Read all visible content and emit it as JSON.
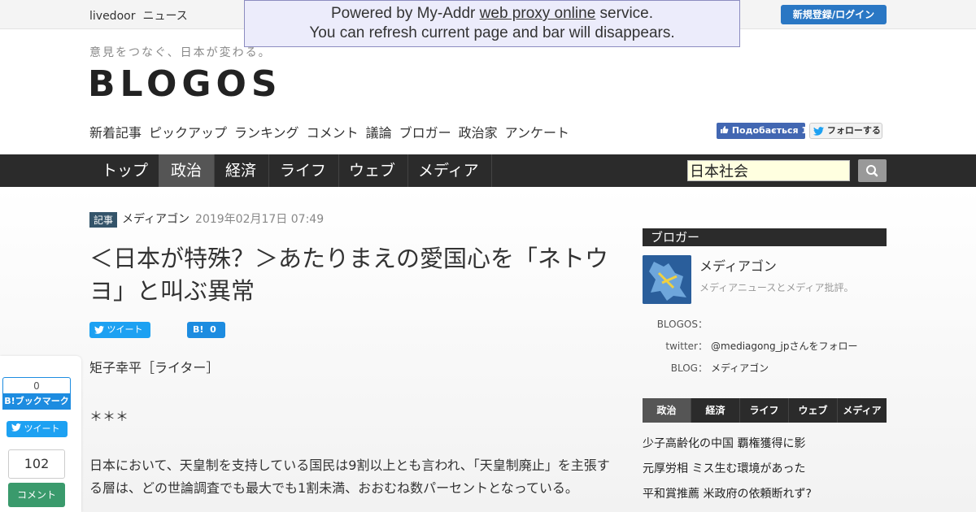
{
  "topbar": {
    "site_name": "livedoor",
    "site_section": "ニュース",
    "login_label": "新規登録/ログイン"
  },
  "proxy_banner": {
    "line1_prefix": "Powered by My-Addr ",
    "line1_link": "web proxy online",
    "line1_suffix": " service.",
    "line2": "You can refresh current page and bar will disappears."
  },
  "header": {
    "tagline": "意見をつなぐ、日本が変わる。",
    "logo": "BLOGOS",
    "subnav": [
      "新着記事",
      "ピックアップ",
      "ランキング",
      "コメント",
      "議論",
      "ブロガー",
      "政治家",
      "アンケート"
    ],
    "fb_label": "Подобається 13",
    "follow_label": "フォローする"
  },
  "mainnav": {
    "tabs": [
      "トップ",
      "政治",
      "経済",
      "ライフ",
      "ウェブ",
      "メディア"
    ],
    "active": "政治",
    "search_value": "日本社会"
  },
  "article": {
    "badge": "記事",
    "author": "メディアゴン",
    "date": "2019年02月17日 07:49",
    "title": "＜日本が特殊？＞あたりまえの愛国心を「ネトウヨ」と叫ぶ異常",
    "tweet_label": "ツイート",
    "hatena_label": "B!",
    "hatena_count": "0",
    "paragraphs": [
      "矩子幸平［ライター］",
      "＊＊＊",
      "日本において、天皇制を支持している国民は9割以上とも言われ、「天皇制廃止」を主張する層は、どの世論調査でも最大でも1割未満、おおむね数パーセントとなっている。"
    ]
  },
  "float_share": {
    "hatena_count": "0",
    "hatena_label": "B!ブックマーク",
    "tweet_label": "ツイート",
    "comment_count": "102",
    "comment_label": "コメント"
  },
  "sidebar": {
    "heading": "ブロガー",
    "blogger_name": "メディアゴン",
    "blogger_desc": "メディアニュースとメディア批評。",
    "blogos_key": "BLOGOS：",
    "twitter_key": "twitter：",
    "twitter_value": "@mediagong_jpさんをフォロー",
    "blog_key": "BLOG：",
    "blog_value": "メディアゴン",
    "cat_tabs": [
      "政治",
      "経済",
      "ライフ",
      "ウェブ",
      "メディア"
    ],
    "cat_active": "政治",
    "links": [
      "少子高齢化の中国 覇権獲得に影",
      "元厚労相 ミス生む環境があった",
      "平和賞推薦 米政府の依頼断れず?"
    ]
  },
  "colors": {
    "nav_bg": "#2b2b2b",
    "login_blue": "#2a77c4",
    "twitter_blue": "#1da1f2",
    "hatena_blue": "#1d8ce0",
    "comment_green": "#3a9a6c",
    "badge": "#34546a"
  }
}
